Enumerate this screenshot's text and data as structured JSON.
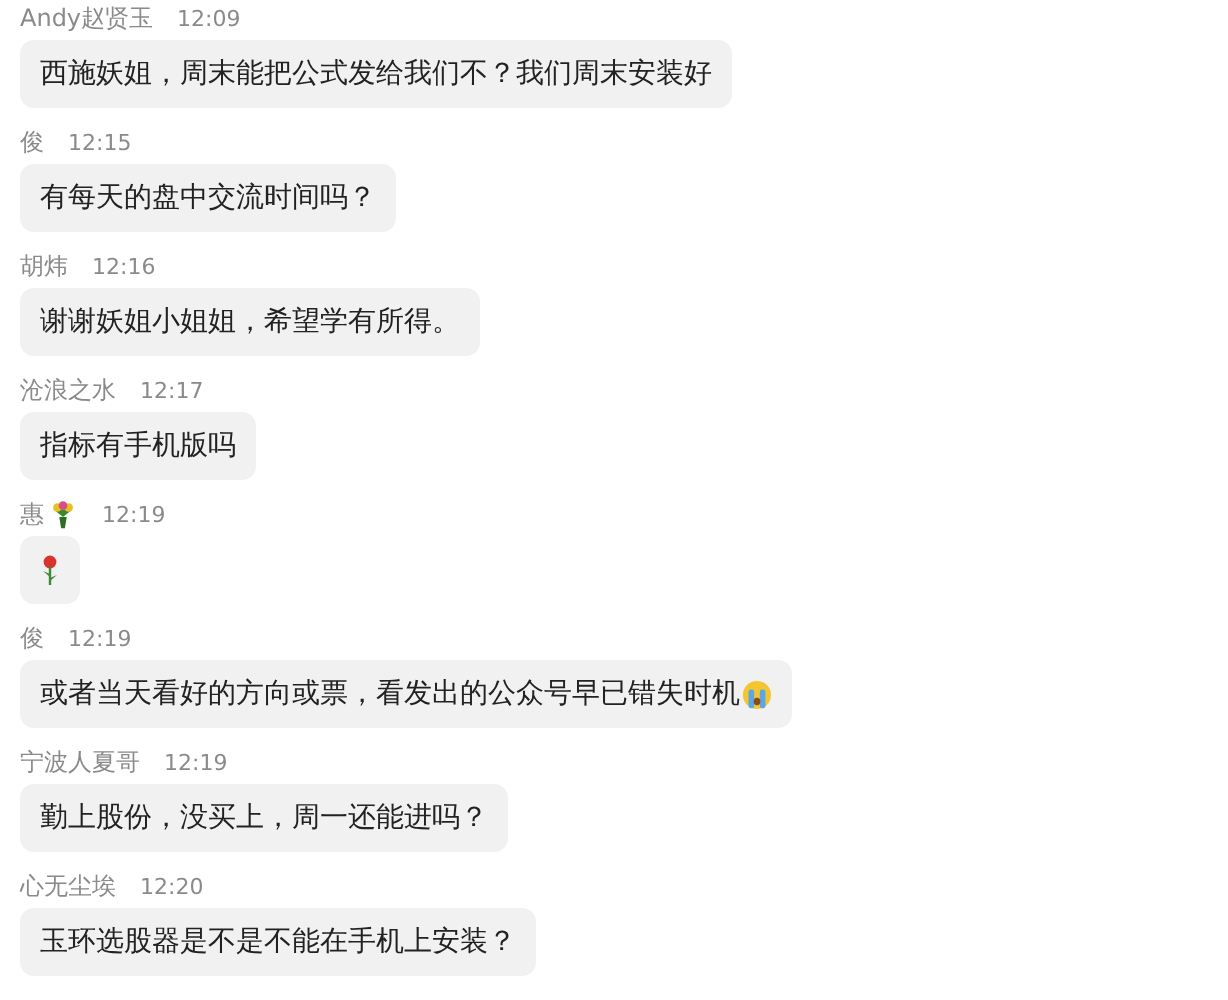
{
  "messages": [
    {
      "sender": "Andy赵贤玉",
      "time": "12:09",
      "text": "西施妖姐，周末能把公式发给我们不？我们周末安装好",
      "kind": "text"
    },
    {
      "sender": "俊",
      "time": "12:15",
      "text": "有每天的盘中交流时间吗？",
      "kind": "text"
    },
    {
      "sender": "胡炜",
      "time": "12:16",
      "text": "谢谢妖姐小姐姐，希望学有所得。",
      "kind": "text"
    },
    {
      "sender": "沧浪之水",
      "time": "12:17",
      "text": "指标有手机版吗",
      "kind": "text"
    },
    {
      "sender": "惠",
      "sender_icon": true,
      "time": "12:19",
      "kind": "icon"
    },
    {
      "sender": "俊",
      "time": "12:19",
      "text": "或者当天看好的方向或票，看发出的公众号早已错失时机",
      "kind": "text-icon"
    },
    {
      "sender": "宁波人夏哥",
      "time": "12:19",
      "text": "勤上股份，没买上，周一还能进吗？",
      "kind": "text"
    },
    {
      "sender": "心无尘埃",
      "time": "12:20",
      "text": "玉环选股器是不是不能在手机上安装？",
      "kind": "text"
    }
  ]
}
